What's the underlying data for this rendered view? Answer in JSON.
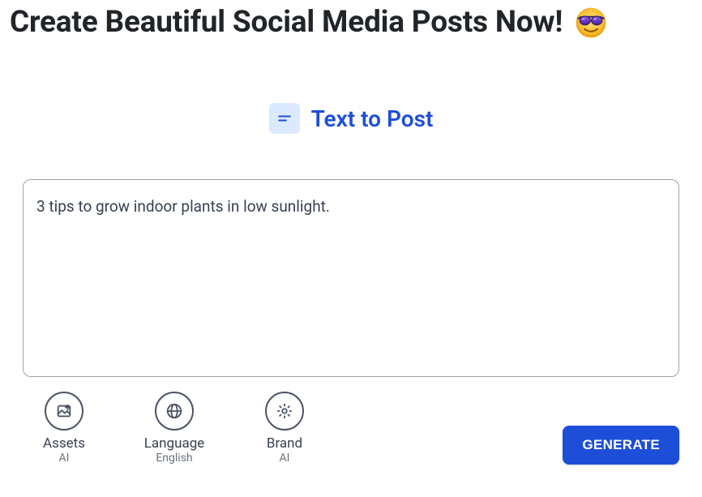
{
  "header": {
    "title": "Create Beautiful Social Media Posts Now!"
  },
  "tab": {
    "label": "Text to Post"
  },
  "prompt": {
    "value": "3 tips to grow indoor plants in low sunlight."
  },
  "options": {
    "assets": {
      "title": "Assets",
      "sub": "AI"
    },
    "language": {
      "title": "Language",
      "sub": "English"
    },
    "brand": {
      "title": "Brand",
      "sub": "AI"
    }
  },
  "actions": {
    "generate": "GENERATE"
  }
}
